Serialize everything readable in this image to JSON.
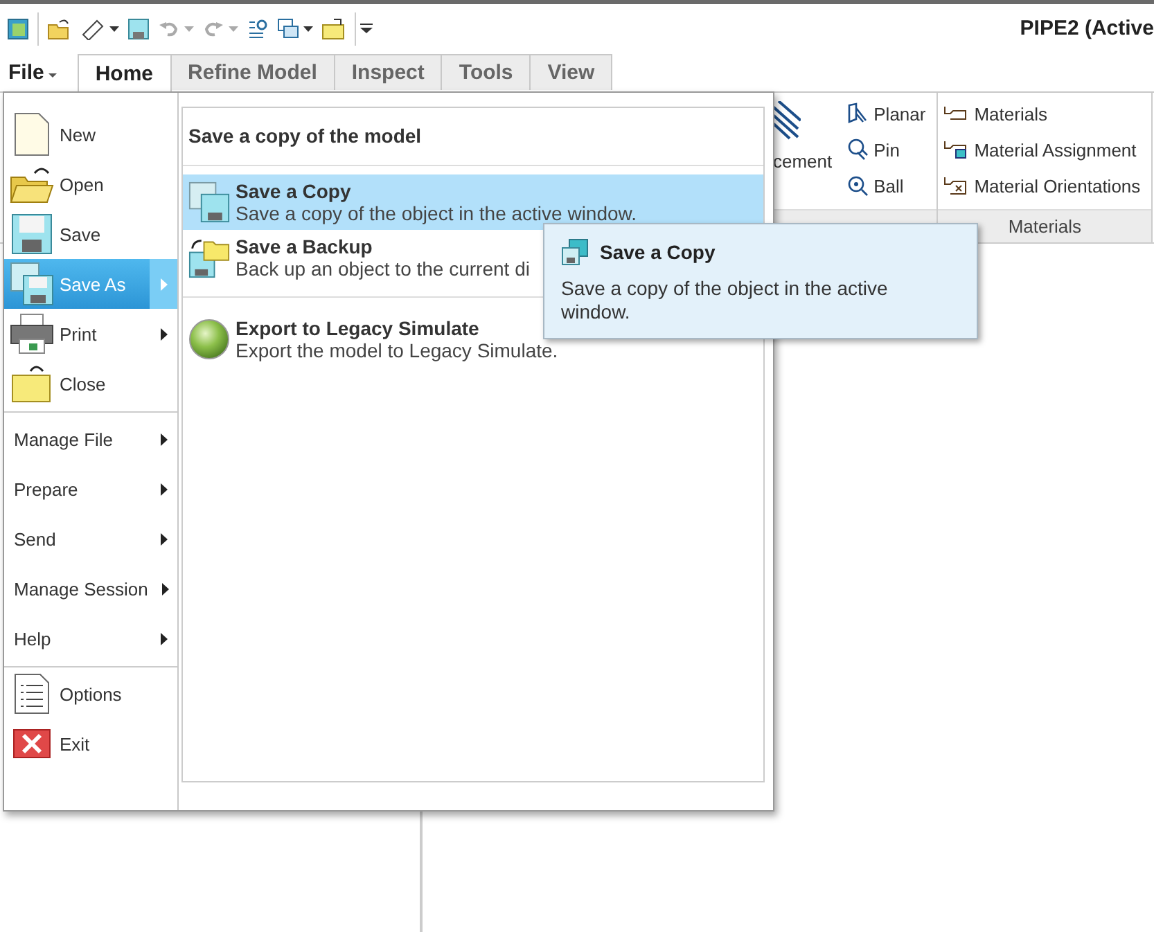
{
  "window": {
    "title": "PIPE2 (Active"
  },
  "file_button": {
    "label": "File"
  },
  "tabs": [
    {
      "label": "Home",
      "selected": true
    },
    {
      "label": "Refine Model",
      "selected": false
    },
    {
      "label": "Inspect",
      "selected": false
    },
    {
      "label": "Tools",
      "selected": false
    },
    {
      "label": "View",
      "selected": false
    }
  ],
  "ribbon": {
    "placement": {
      "label": "cement"
    },
    "connections": [
      {
        "label": "Planar"
      },
      {
        "label": "Pin"
      },
      {
        "label": "Ball"
      }
    ],
    "materials": {
      "label": "Materials",
      "items": [
        {
          "label": "Materials"
        },
        {
          "label": "Material Assignment"
        },
        {
          "label": "Material Orientations"
        }
      ]
    }
  },
  "file_menu": {
    "sections": [
      [
        {
          "label": "New",
          "selected": false,
          "submenu": false
        },
        {
          "label": "Open",
          "selected": false,
          "submenu": false
        },
        {
          "label": "Save",
          "selected": false,
          "submenu": false
        },
        {
          "label": "Save As",
          "selected": true,
          "submenu": true
        },
        {
          "label": "Print",
          "selected": false,
          "submenu": true
        },
        {
          "label": "Close",
          "selected": false,
          "submenu": false
        }
      ],
      [
        {
          "label": "Manage File",
          "selected": false,
          "submenu": true
        },
        {
          "label": "Prepare",
          "selected": false,
          "submenu": true
        },
        {
          "label": "Send",
          "selected": false,
          "submenu": true
        },
        {
          "label": "Manage Session",
          "selected": false,
          "submenu": true
        },
        {
          "label": "Help",
          "selected": false,
          "submenu": true
        }
      ],
      [
        {
          "label": "Options",
          "selected": false,
          "submenu": false
        },
        {
          "label": "Exit",
          "selected": false,
          "submenu": false
        }
      ]
    ],
    "panel": {
      "title": "Save a copy of the model",
      "groups": [
        [
          {
            "title": "Save a Copy",
            "description": "Save a copy of the object in the active window.",
            "selected": true
          },
          {
            "title": "Save a Backup",
            "description": "Back up an object to the current di",
            "selected": false
          }
        ],
        [
          {
            "title": "Export to Legacy Simulate",
            "description": "Export the model to Legacy Simulate.",
            "selected": false
          }
        ]
      ]
    }
  },
  "tooltip": {
    "title": "Save a Copy",
    "text": "Save a copy of the object in the active window."
  }
}
